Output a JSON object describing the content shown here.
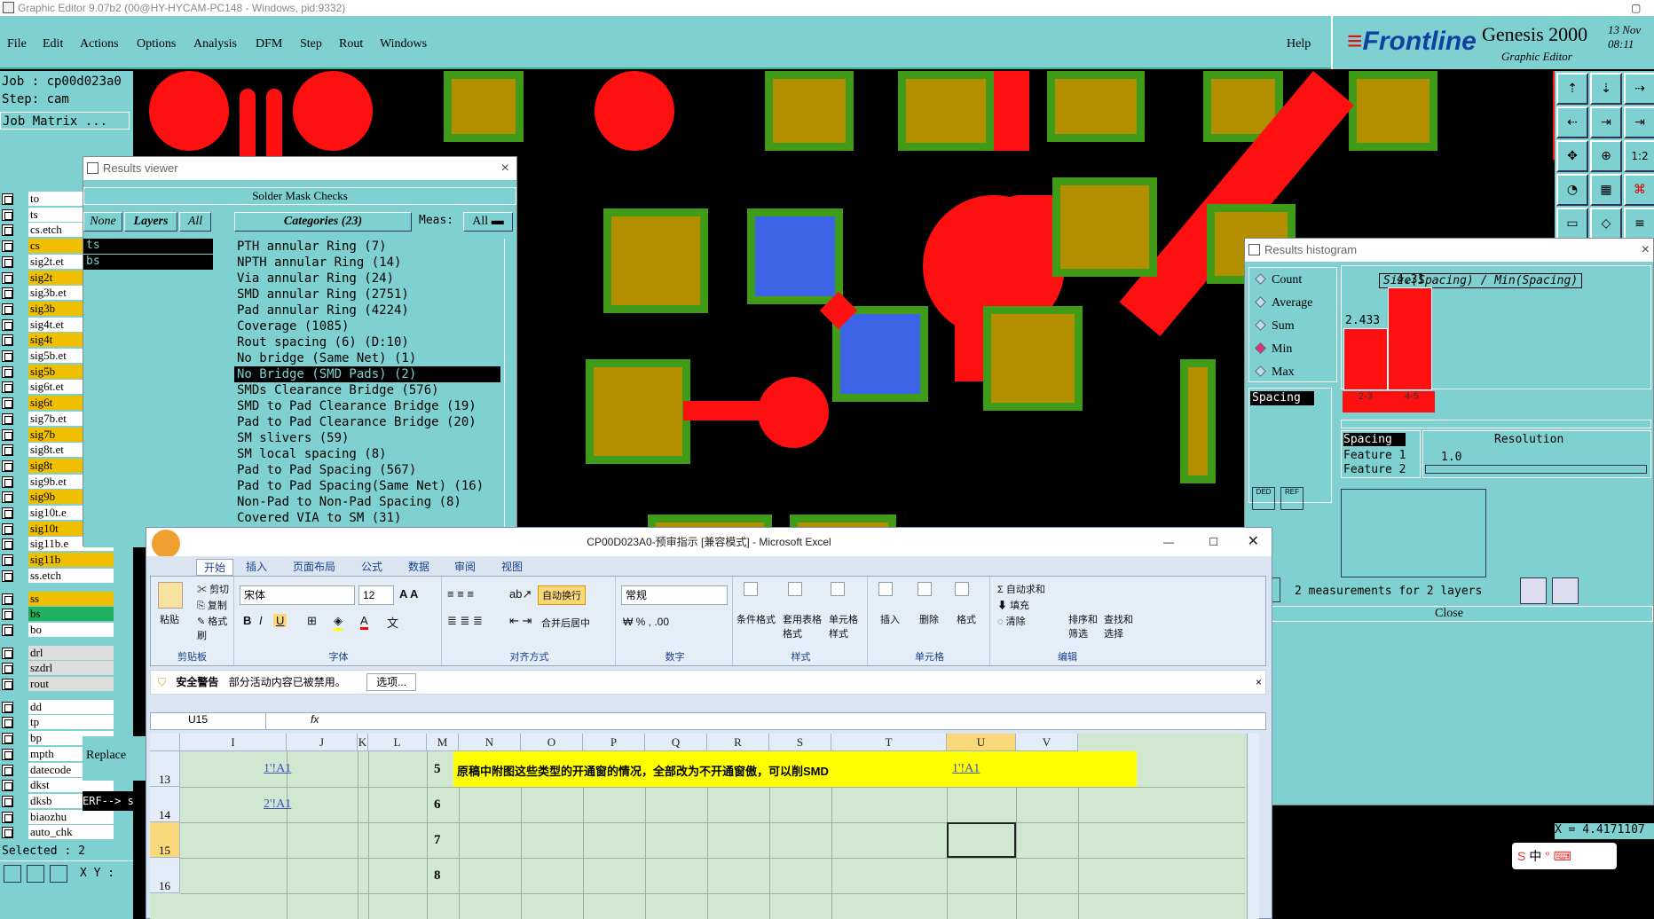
{
  "app": {
    "title": "Graphic Editor 9.07b2 (00@HY-HYCAM-PC148 - Windows, pid:9332)"
  },
  "menu": [
    "File",
    "Edit",
    "Actions",
    "Options",
    "Analysis",
    "DFM",
    "Step",
    "Rout",
    "Windows"
  ],
  "help": "Help",
  "brand": {
    "logo": "Frontline",
    "product": "Genesis 2000",
    "subtitle": "Graphic Editor",
    "date1": "13 Nov",
    "date2": "08:11"
  },
  "left": {
    "job": "Job : cp00d023a0",
    "step": "Step: cam",
    "matrix": "Job Matrix ...",
    "layers": [
      "to",
      "ts",
      "cs.etch",
      "cs",
      "sig2t.et",
      "sig2t",
      "sig3b.et",
      "sig3b",
      "sig4t.et",
      "sig4t",
      "sig5b.et",
      "sig5b",
      "sig6t.et",
      "sig6t",
      "sig7b.et",
      "sig7b",
      "sig8t.et",
      "sig8t",
      "sig9b.et",
      "sig9b",
      "sig10t.e",
      "sig10t",
      "sig11b.e",
      "sig11b",
      "ss.etch",
      "ss",
      "bs",
      "bo",
      "drl",
      "szdrl",
      "rout",
      "dd",
      "tp",
      "bp",
      "mpth",
      "datecode",
      "dkst",
      "dksb",
      "biaozhu",
      "auto_chk"
    ],
    "selected": "Selected : 2",
    "xy": "X Y :"
  },
  "results_viewer": {
    "title": "Results viewer",
    "header": "Solder Mask Checks",
    "none": "None",
    "layers": "Layers",
    "all": "All",
    "categories": "Categories (23)",
    "meas": "Meas:",
    "meas_value": "All",
    "layer_items": [
      "ts",
      "bs"
    ],
    "items": [
      "PTH annular Ring (7)",
      "NPTH annular Ring (14)",
      "Via annular Ring (24)",
      "SMD annular Ring (2751)",
      "Pad annular Ring (4224)",
      "Coverage (1085)",
      "Rout spacing (6)          (D:10)",
      "No bridge (Same Net) (1)",
      "No Bridge (SMD Pads) (2)",
      "SMDs Clearance Bridge (576)",
      "SMD to Pad Clearance Bridge (19)",
      "Pad to Pad Clearance Bridge (20)",
      "SM slivers (59)",
      "SM local spacing (8)",
      "Pad to Pad Spacing (567)",
      "Pad to Pad Spacing(Same Net) (16)",
      "Non-Pad to Non-Pad Spacing (8)",
      "Covered VIA to SM (31)"
    ],
    "replace": "Replace",
    "erf": "ERF--> s"
  },
  "histogram": {
    "title": "Results histogram",
    "modes": [
      "Count",
      "Average",
      "Sum",
      "Min",
      "Max"
    ],
    "selected_mode": "Min",
    "list_item": "Spacing",
    "chart_title": "Size(Spacing) / Min(Spacing)",
    "bars": [
      {
        "label": "2-3",
        "value": "2.433"
      },
      {
        "label": "4-5",
        "value": "4.31"
      }
    ],
    "feature_label": "Spacing",
    "feature1": "Feature 1",
    "feature2": "Feature 2",
    "resolution_label": "Resolution",
    "resolution_value": "1.0",
    "measurements": "2 measurements for 2 layers",
    "close": "Close",
    "coord": "X = 4.4171107"
  },
  "excel": {
    "title": "CP00D023A0-预审指示  [兼容模式] - Microsoft Excel",
    "tabs": [
      "开始",
      "插入",
      "页面布局",
      "公式",
      "数据",
      "审阅",
      "视图"
    ],
    "ribbon": {
      "paste": "粘贴",
      "cut": "剪切",
      "copy": "复制",
      "format_painter": "格式刷",
      "clipboard": "剪贴板",
      "font_name": "宋体",
      "font_size": "12",
      "font": "字体",
      "wrap": "自动换行",
      "merge": "合并后居中",
      "align": "对齐方式",
      "numfmt": "常规",
      "number": "数字",
      "cond": "条件格式",
      "table_fmt": "套用表格格式",
      "cell_style": "单元格样式",
      "styles": "样式",
      "insert": "插入",
      "delete": "删除",
      "format": "格式",
      "cells": "单元格",
      "autosum": "自动求和",
      "fill": "填充",
      "clear": "清除",
      "sort": "排序和筛选",
      "find": "查找和选择",
      "edit": "编辑"
    },
    "security_title": "安全警告",
    "security_msg": "部分活动内容已被禁用。",
    "options_btn": "选项...",
    "namebox": "U15",
    "columns": [
      "I",
      "J",
      "K",
      "L",
      "M",
      "N",
      "O",
      "P",
      "Q",
      "R",
      "S",
      "T",
      "U",
      "V"
    ],
    "rows": [
      {
        "num": "13",
        "m": "5",
        "j": "1'!A1",
        "note": "原稿中附图这些类型的开通窗的情况，全部改为不开通窗傲，可以削SMD",
        "u": "1'!A1"
      },
      {
        "num": "14",
        "m": "6",
        "j": "2'!A1",
        "note": "",
        "u": ""
      },
      {
        "num": "15",
        "m": "7",
        "j": "",
        "note": "",
        "u": ""
      },
      {
        "num": "16",
        "m": "8",
        "j": "",
        "note": "",
        "u": ""
      }
    ]
  },
  "tray": {
    "lang": "中"
  }
}
